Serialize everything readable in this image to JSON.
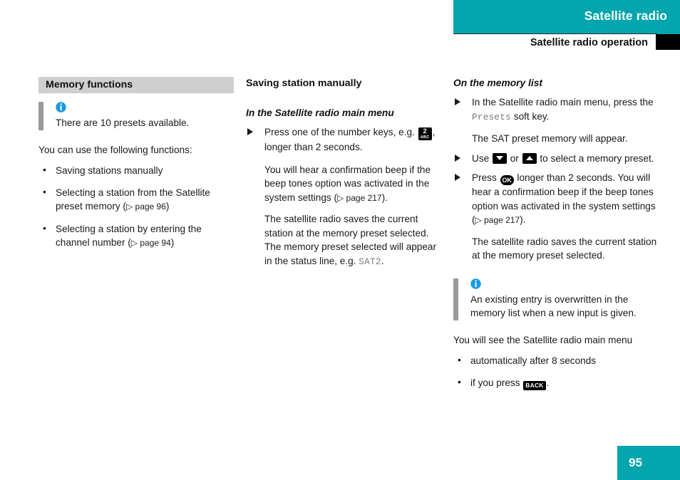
{
  "header": {
    "band_title": "Satellite radio",
    "sub_title": "Satellite radio operation",
    "band_color": "#00a5ad",
    "tab_color": "#000000"
  },
  "left_column": {
    "section_head": "Memory functions",
    "note": {
      "icon": "info-icon",
      "text": "There are 10 presets available."
    },
    "intro": "You can use the following functions:",
    "bullets": [
      {
        "text": "Saving stations manually",
        "ref_prefix": "",
        "ref": ""
      },
      {
        "text": "Selecting a station from the Satellite preset memory (",
        "ref": "▷ page 96",
        "ref_suffix": ")"
      },
      {
        "text": "Selecting a station by entering the channel number (",
        "ref": "▷ page 94",
        "ref_suffix": ")"
      }
    ],
    "bullet_1_text": "Saving stations manually",
    "bullet_2_text": "Selecting a station from the Satellite preset memory (",
    "bullet_2_ref": "▷ page 96",
    "bullet_2_close": ")",
    "bullet_3_text": "Selecting a station by entering the channel number (",
    "bullet_3_ref": "▷ page 94",
    "bullet_3_close": ")"
  },
  "mid_column": {
    "head": "Saving station manually",
    "sub_head": "In the Satellite radio main menu",
    "step_1": {
      "text_before": "Press one of the number keys, e.g.",
      "key": {
        "name": "number-key-2",
        "top": "2",
        "bottom": "ABC"
      },
      "text_after": ", longer than 2 seconds."
    },
    "para_1": "You will hear a confirmation beep if the beep tones option was activated in the system settings (",
    "para_1_ref": "▷ page 217",
    "para_1_close": ").",
    "para_2": "The satellite radio saves the current station at the memory preset selected. The memory preset selected will appear in the status line, e.g.",
    "para_2_mono": "SAT2",
    "para_2_close": "."
  },
  "right_column": {
    "sub_head": "On the memory list",
    "step_1": {
      "text_before": "In the Satellite radio main menu, press the",
      "mono": "Presets",
      "text_after": "soft key."
    },
    "step_1_note": "The SAT preset memory will appear.",
    "step_2": {
      "text_before": "Use",
      "key_down": "down-arrow-key",
      "text_mid": "or",
      "key_up": "up-arrow-key",
      "text_after": "to select a memory preset."
    },
    "step_3": {
      "text_before": "Press",
      "key_ok": "OK",
      "text_after": "longer than 2 seconds. You will hear a confirmation beep if the beep tones option was activated in the system settings ("
    },
    "step_3_ref": "▷ page 217",
    "step_3_close": ").",
    "step_3_para": "The satellite radio saves the current station at the memory preset selected.",
    "note": {
      "icon": "info-icon",
      "text": "An existing entry is overwritten in the memory list when a new input is given."
    },
    "closing_intro": "You will see the Satellite radio main menu",
    "bullet_1": "automatically after 8 seconds",
    "bullet_2_before": "if you press",
    "bullet_2_key": "BACK",
    "bullet_2_after": "."
  },
  "footer": {
    "page_number": "95",
    "block_color": "#00a5ad"
  }
}
